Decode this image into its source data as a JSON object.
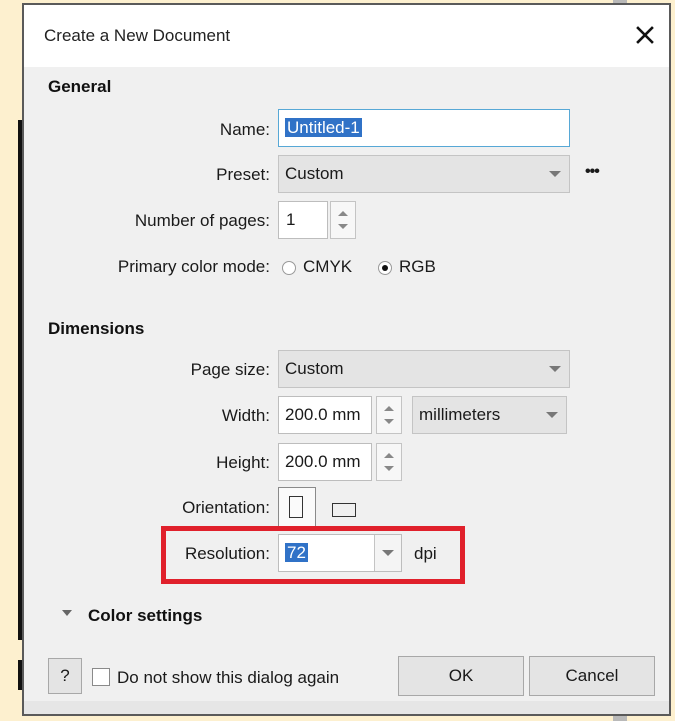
{
  "dialog": {
    "title": "Create a New Document",
    "general": {
      "heading": "General",
      "name_label": "Name:",
      "name_value": "Untitled-1",
      "preset_label": "Preset:",
      "preset_value": "Custom",
      "more_label": "•••",
      "pages_label": "Number of pages:",
      "pages_value": "1",
      "color_mode_label": "Primary color mode:",
      "color_modes": [
        {
          "label": "CMYK",
          "selected": false
        },
        {
          "label": "RGB",
          "selected": true
        }
      ]
    },
    "dimensions": {
      "heading": "Dimensions",
      "page_size_label": "Page size:",
      "page_size_value": "Custom",
      "width_label": "Width:",
      "width_value": "200.0 mm",
      "units_value": "millimeters",
      "height_label": "Height:",
      "height_value": "200.0 mm",
      "orientation_label": "Orientation:",
      "resolution_label": "Resolution:",
      "resolution_value": "72",
      "resolution_unit": "dpi"
    },
    "color_settings_label": "Color settings",
    "footer": {
      "help_label": "?",
      "dont_show_label": "Do not show this dialog again",
      "ok_label": "OK",
      "cancel_label": "Cancel"
    }
  },
  "colors": {
    "accent_selection": "#3072c7",
    "highlight_red": "#e0202b",
    "page_background": "#fdf0cf"
  }
}
